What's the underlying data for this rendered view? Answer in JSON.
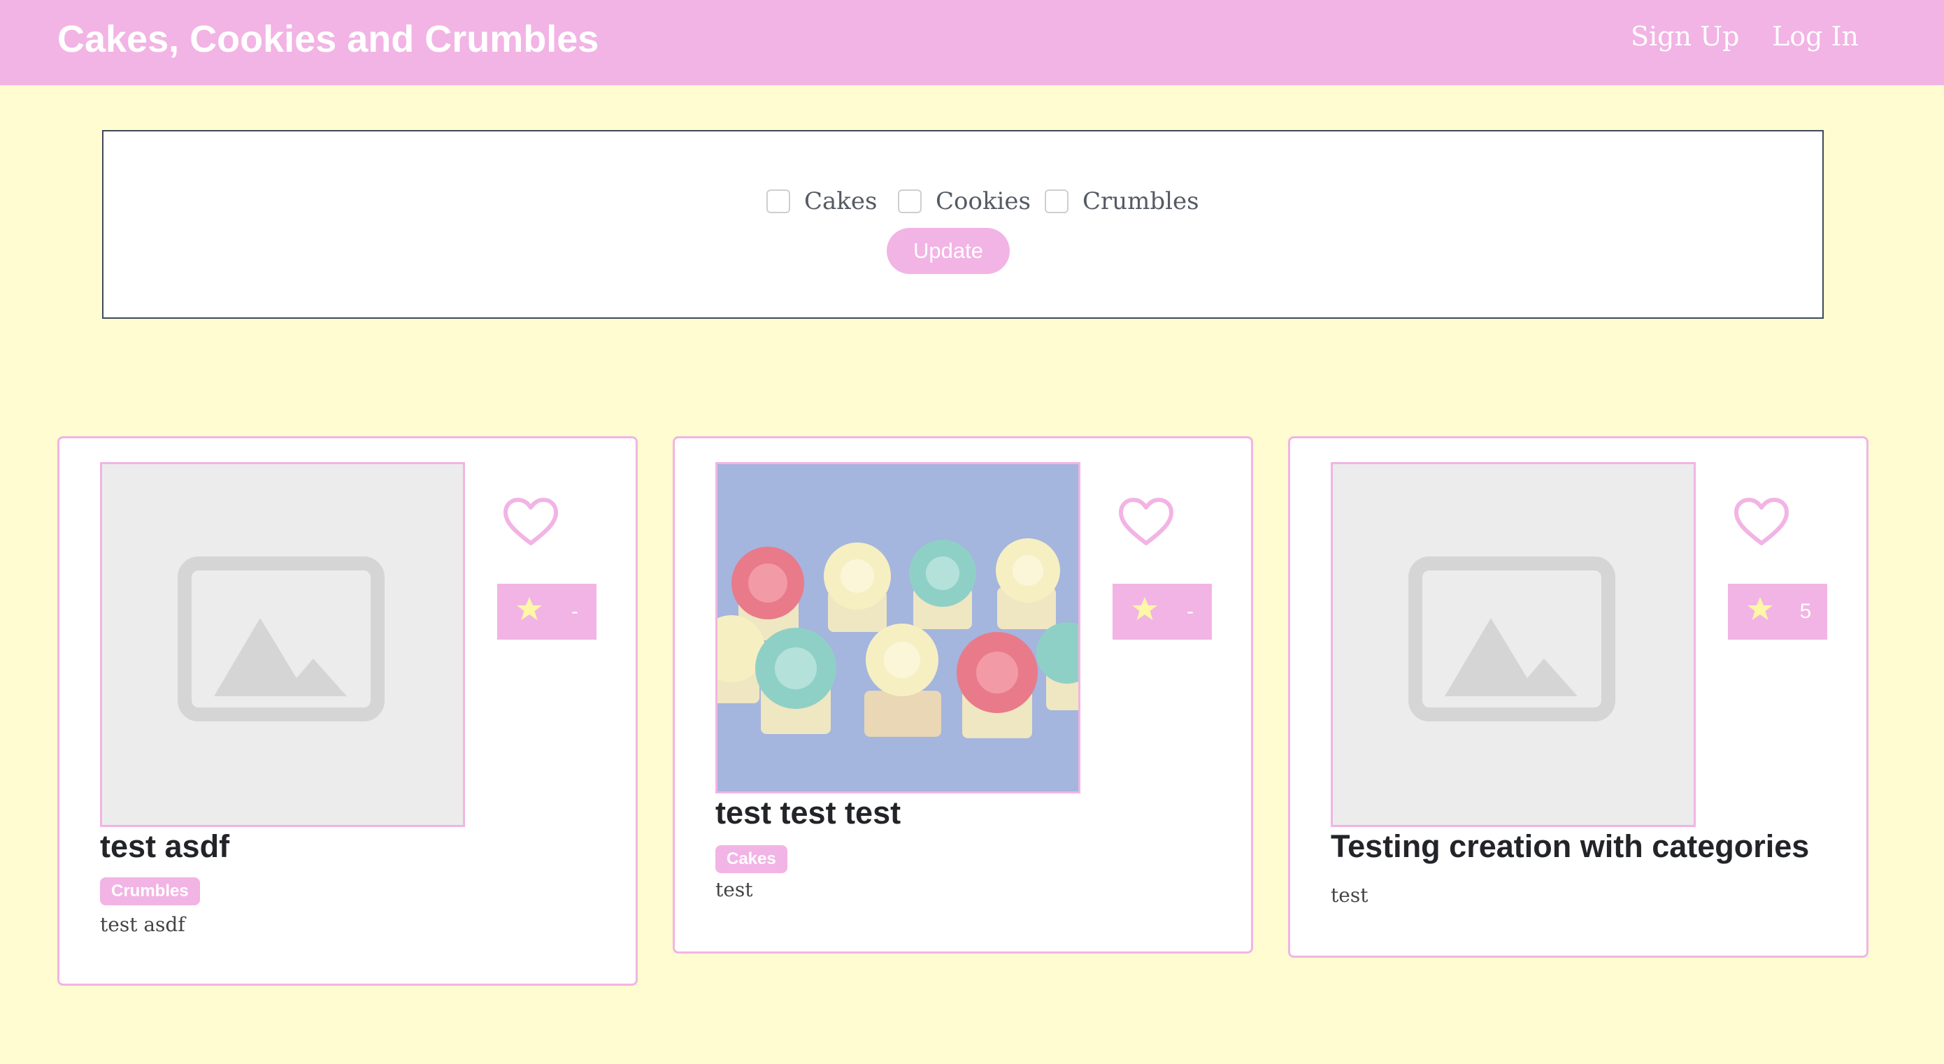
{
  "navbar": {
    "brand": "Cakes, Cookies and Crumbles",
    "sign_up": "Sign Up",
    "log_in": "Log In"
  },
  "filters": {
    "options": [
      {
        "label": "Cakes",
        "checked": false
      },
      {
        "label": "Cookies",
        "checked": false
      },
      {
        "label": "Crumbles",
        "checked": false
      }
    ],
    "update_label": "Update"
  },
  "recipes": [
    {
      "title": "test asdf",
      "category": "Crumbles",
      "description": "test asdf",
      "rating": "-",
      "image": "placeholder-image-icon",
      "favorited": false
    },
    {
      "title": "test test test",
      "category": "Cakes",
      "description": "test",
      "rating": "-",
      "image": "cupcakes-photo",
      "favorited": false
    },
    {
      "title": "Testing creation with categories",
      "category": "",
      "description": "test",
      "rating": "5",
      "image": "placeholder-image-icon",
      "favorited": false
    }
  ],
  "colors": {
    "background": "#fefcd0",
    "accent": "#f2b4e4",
    "placeholder": "#ececec"
  }
}
